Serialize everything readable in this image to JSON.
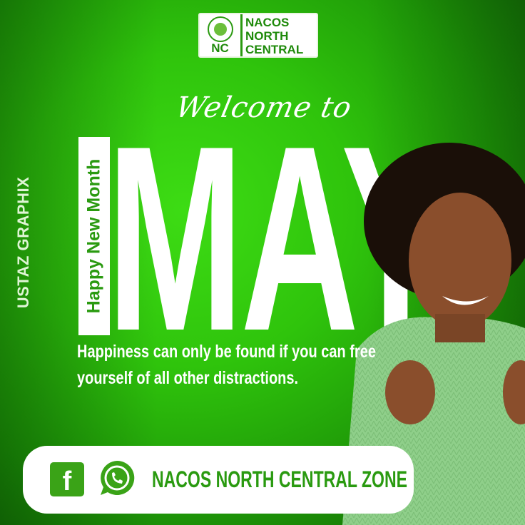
{
  "logo": {
    "initials": "NC",
    "line1": "NACOS",
    "line2": "NORTH",
    "line3": "CENTRAL"
  },
  "headline": {
    "welcome": "Welcome to",
    "month": "MAY",
    "tag": "Happy New Month"
  },
  "credit": "USTAZ GRAPHIX",
  "quote": "Happiness can only be found if you can free yourself of all other distractions.",
  "footer": {
    "facebook_icon": "facebook-icon",
    "whatsapp_icon": "whatsapp-icon",
    "label": "NACOS NORTH CENTRAL ZONE"
  },
  "colors": {
    "brand_green": "#2a9a10",
    "background": "#2fc40c"
  }
}
